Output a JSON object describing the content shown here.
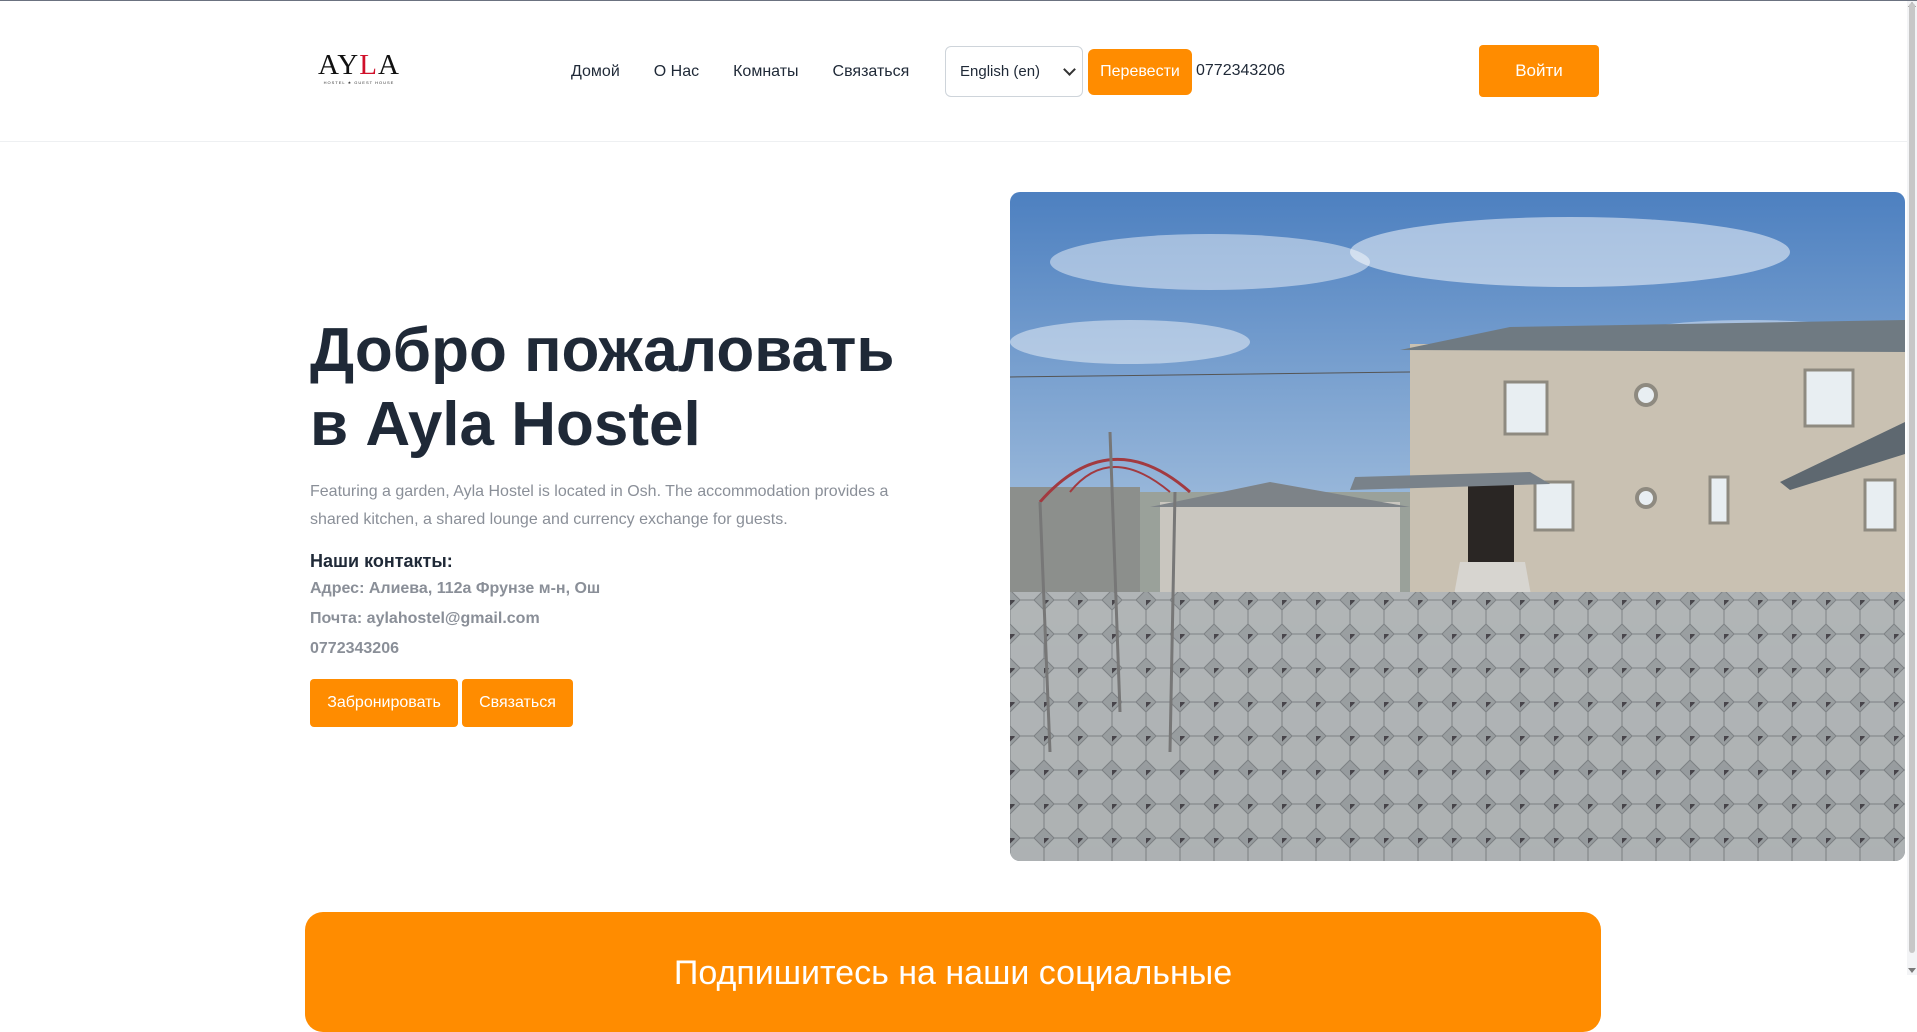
{
  "brand": {
    "logo_text": "AYLA",
    "logo_tagline": "HOSTEL ★ GUEST HOUSE"
  },
  "nav": {
    "items": [
      {
        "label": "Домой"
      },
      {
        "label": "О Нас"
      },
      {
        "label": "Комнаты"
      },
      {
        "label": "Связаться"
      }
    ]
  },
  "header": {
    "language_selected": "English (en)",
    "translate_label": "Перевести",
    "phone": "0772343206",
    "login_label": "Войти"
  },
  "hero": {
    "title_line1": "Добро пожаловать",
    "title_line2": "в Ayla Hostel",
    "description": "Featuring a garden, Ayla Hostel is located in Osh. The accommodation provides a shared kitchen, a shared lounge and currency exchange for guests.",
    "contacts_heading": "Наши контакты:",
    "address": "Адрес: Алиева, 112а Фрунзе м-н, Ош",
    "email": "Почта: aylahostel@gmail.com",
    "phone": "0772343206",
    "book_label": "Забронировать",
    "contact_label": "Связаться"
  },
  "promo": {
    "title": "Подпишитесь на наши социальные"
  },
  "colors": {
    "accent": "#ff8c00",
    "text": "#1f2937",
    "muted": "#8a8f98"
  }
}
